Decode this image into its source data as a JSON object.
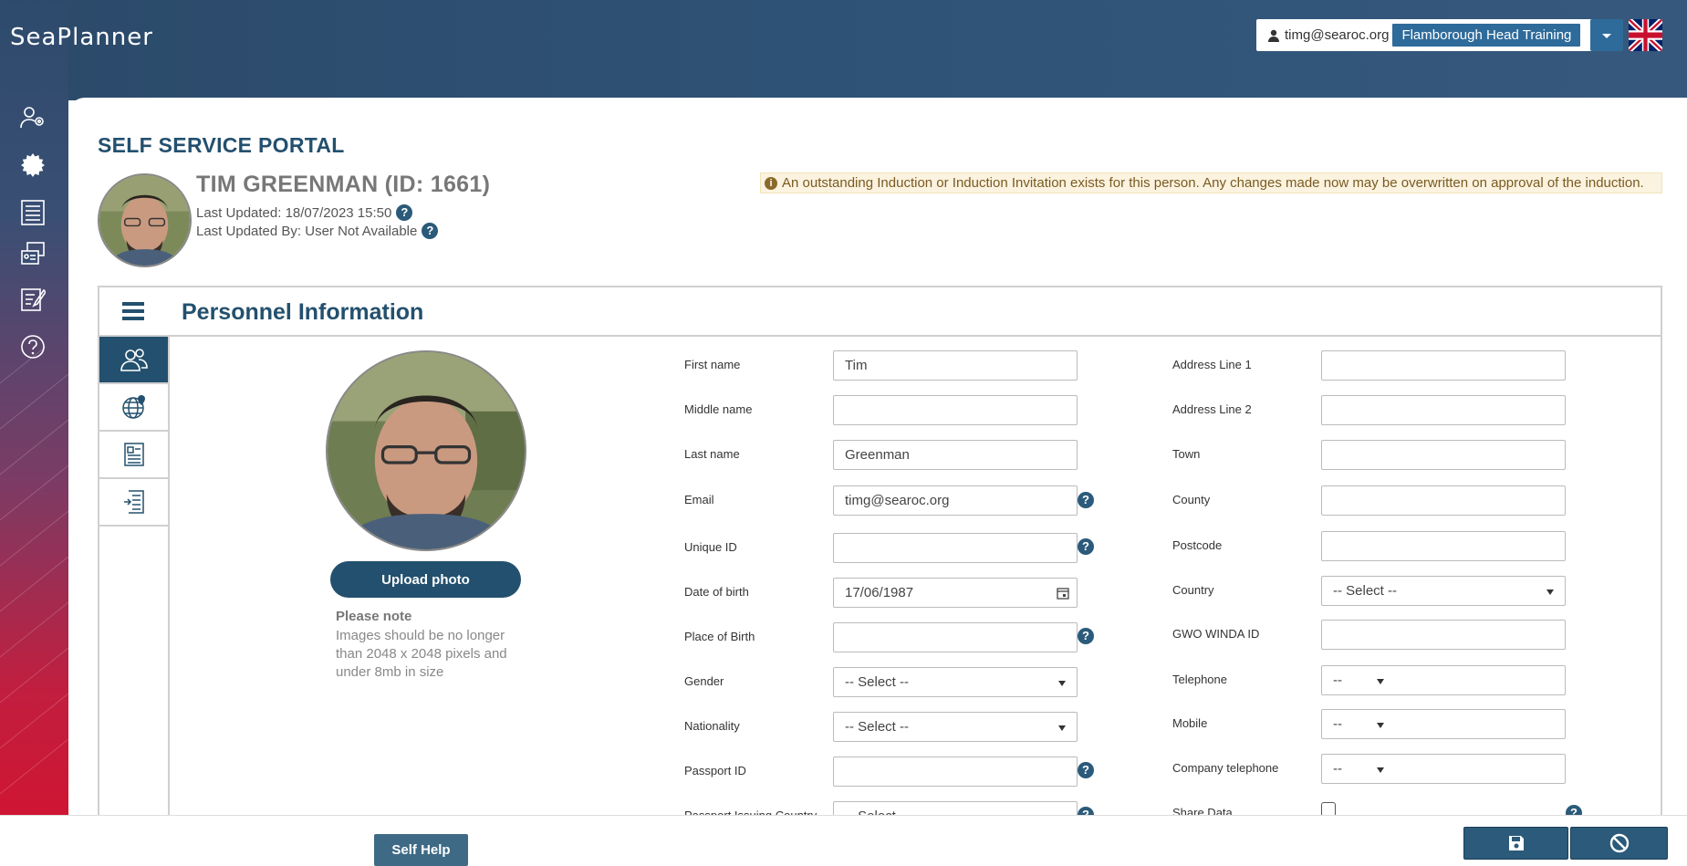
{
  "app": {
    "logo": "SeaPlanner"
  },
  "header": {
    "user_email": "timg@searoc.org",
    "organisation": "Flamborough Head Training",
    "language_icon": "uk-flag-icon"
  },
  "nav": {
    "items": [
      {
        "icon": "personnel-settings-icon"
      },
      {
        "icon": "badge-icon"
      },
      {
        "icon": "document-list-icon"
      },
      {
        "icon": "id-cards-icon"
      },
      {
        "icon": "edit-form-icon"
      },
      {
        "icon": "help-icon"
      }
    ]
  },
  "page": {
    "title": "SELF SERVICE PORTAL",
    "person_name": "TIM GREENMAN (ID: 1661)",
    "last_updated": "Last Updated: 18/07/2023 15:50",
    "last_updated_by": "Last Updated By: User Not Available",
    "warning": "An outstanding Induction or Induction Invitation exists for this person. Any changes made now may be overwritten on approval of the induction."
  },
  "panel": {
    "title": "Personnel Information",
    "tabs": [
      {
        "icon": "people-icon"
      },
      {
        "icon": "globe-location-icon"
      },
      {
        "icon": "document-icon"
      },
      {
        "icon": "checklist-icon"
      }
    ],
    "upload_label": "Upload photo",
    "note_title": "Please note",
    "note_text": "Images should be no longer than 2048 x 2048 pixels and under 8mb in size"
  },
  "form": {
    "left": [
      {
        "label": "First name",
        "value": "Tim"
      },
      {
        "label": "Middle name",
        "value": ""
      },
      {
        "label": "Last name",
        "value": "Greenman"
      },
      {
        "label": "Email",
        "value": "timg@searoc.org"
      },
      {
        "label": "Unique ID",
        "value": ""
      },
      {
        "label": "Date of birth",
        "value": "17/06/1987"
      },
      {
        "label": "Place of Birth",
        "value": ""
      },
      {
        "label": "Gender",
        "value": "-- Select --"
      },
      {
        "label": "Nationality",
        "value": "-- Select --"
      },
      {
        "label": "Passport ID",
        "value": ""
      },
      {
        "label": "Passport Issuing Country",
        "value": "-- Select --"
      }
    ],
    "right": [
      {
        "label": "Address Line 1",
        "value": ""
      },
      {
        "label": "Address Line 2",
        "value": ""
      },
      {
        "label": "Town",
        "value": ""
      },
      {
        "label": "County",
        "value": ""
      },
      {
        "label": "Postcode",
        "value": ""
      },
      {
        "label": "Country",
        "value": "-- Select --"
      },
      {
        "label": "GWO WINDA ID",
        "value": ""
      },
      {
        "label": "Telephone",
        "value": "--"
      },
      {
        "label": "Mobile",
        "value": "--"
      },
      {
        "label": "Company telephone",
        "value": "--"
      },
      {
        "label": "Share Data",
        "value": ""
      }
    ],
    "help_glyph": "?"
  },
  "footer": {
    "self_help": "Self Help"
  }
}
